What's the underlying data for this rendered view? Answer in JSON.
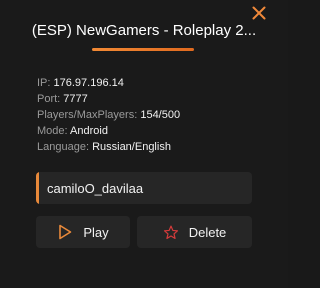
{
  "dialog": {
    "title": "(ESP) NewGamers - Roleplay 2...",
    "close_icon": "close-icon",
    "accent_color": "#e8893a"
  },
  "server_info": {
    "ip": {
      "label": "IP:",
      "value": "176.97.196.14"
    },
    "port": {
      "label": "Port:",
      "value": "7777"
    },
    "players": {
      "label": "Players/MaxPlayers:",
      "value": "154/500"
    },
    "mode": {
      "label": "Mode:",
      "value": "Android"
    },
    "language": {
      "label": "Language:",
      "value": "Russian/English"
    }
  },
  "nickname": {
    "value": "camiloO_davilaa"
  },
  "actions": {
    "play_label": "Play",
    "play_icon": "play-icon",
    "delete_label": "Delete",
    "delete_icon": "star-icon"
  }
}
